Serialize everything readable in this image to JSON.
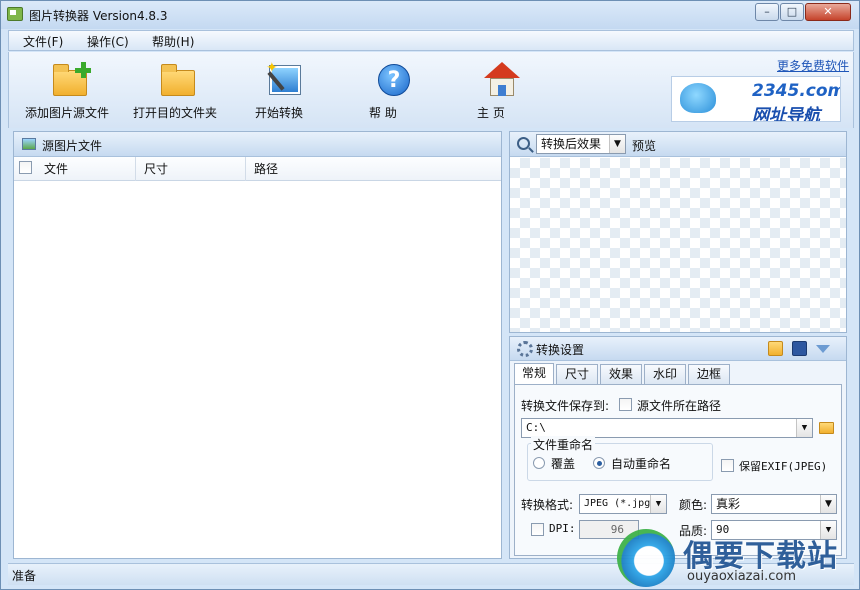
{
  "window": {
    "title": "图片转换器 Version4.8.3",
    "min_glyph": "–",
    "max_glyph": "□",
    "close_glyph": "✕"
  },
  "menu": [
    "文件(F)",
    "操作(C)",
    "帮助(H)"
  ],
  "toolbar": {
    "add_source": "添加图片源文件",
    "open_dest": "打开目的文件夹",
    "start": "开始转换",
    "help": "帮 助",
    "home": "主 页"
  },
  "ad": {
    "link_text": "更多免费软件",
    "brand": "2345.com",
    "tagline": "网址导航"
  },
  "source_panel": {
    "title": "源图片文件",
    "columns": [
      "文件",
      "尺寸",
      "路径"
    ],
    "rows": []
  },
  "preview_panel": {
    "mode_select": "转换后效果",
    "label": "预览"
  },
  "settings_panel": {
    "title": "转换设置",
    "tabs": [
      "常规",
      "尺寸",
      "效果",
      "水印",
      "边框"
    ],
    "active_tab": "常规",
    "save_to_label": "转换文件保存到:",
    "source_path_checkbox": "源文件所在路径",
    "save_path_value": "C:\\",
    "rename_group": "文件重命名",
    "rename_overwrite": "覆盖",
    "rename_auto": "自动重命名",
    "rename_selected": "自动重命名",
    "keep_exif": "保留EXIF(JPEG)",
    "format_label": "转换格式:",
    "format_value": "JPEG (*.jpg",
    "color_label": "颜色:",
    "color_value": "真彩",
    "dpi_label": "DPI:",
    "dpi_value": "96",
    "quality_label": "品质:",
    "quality_value": "90"
  },
  "status": {
    "text": "准备"
  },
  "watermark": {
    "title": "偶要下载站",
    "domain": "ouyaoxiazai.com"
  },
  "colors": {
    "accent": "#1f56b8",
    "window_bg": "#d4e5f7",
    "close_red": "#c5432b"
  }
}
